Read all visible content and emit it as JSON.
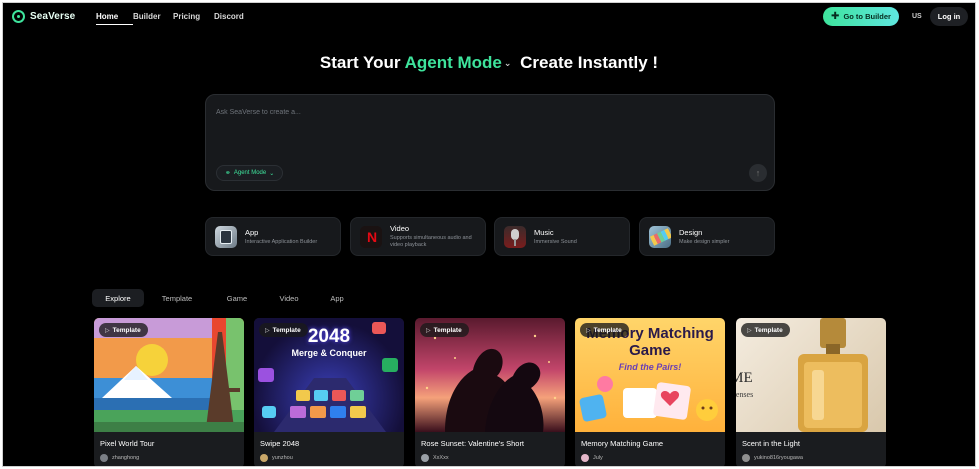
{
  "nav": {
    "brand": "SeaVerse",
    "links": [
      {
        "label": "Home",
        "active": true
      },
      {
        "label": "Builder",
        "active": false
      },
      {
        "label": "Pricing",
        "active": false
      },
      {
        "label": "Discord",
        "active": false
      }
    ],
    "builder_button": "Go to Builder",
    "locale": "US",
    "login_button": "Log in"
  },
  "hero": {
    "prefix": "Start Your",
    "mode": "Agent Mode",
    "suffix": "Create Instantly !"
  },
  "prompt": {
    "placeholder": "Ask SeaVerse to create a...",
    "mode_label": "Agent Mode"
  },
  "categories": [
    {
      "title": "App",
      "subtitle": "Interactive Application Builder"
    },
    {
      "title": "Video",
      "subtitle": "Supports simultaneous audio and video playback"
    },
    {
      "title": "Music",
      "subtitle": "Immersive Sound"
    },
    {
      "title": "Design",
      "subtitle": "Make design simpler"
    }
  ],
  "tabs": [
    "Explore",
    "Template",
    "Game",
    "Video",
    "App"
  ],
  "badge_label": "Template",
  "cards": [
    {
      "title": "Pixel World Tour",
      "author": "zhanghong"
    },
    {
      "title": "Swipe 2048",
      "author": "yunzhou",
      "image_text": "2048",
      "image_subtext": "Merge & Conquer"
    },
    {
      "title": "Rose Sunset: Valentine's Short",
      "author": "XxXxx"
    },
    {
      "title": "Memory Matching Game",
      "author": "July",
      "image_text": "Memory Matching Game",
      "image_subtext": "Find the Pairs!"
    },
    {
      "title": "Scent in the Light",
      "author": "yukino816ryougawa",
      "image_text": "UME",
      "image_subtext": "r Senses"
    }
  ],
  "colors": {
    "accent": "#3ee39c",
    "background": "#000000",
    "panel": "#17191c"
  }
}
